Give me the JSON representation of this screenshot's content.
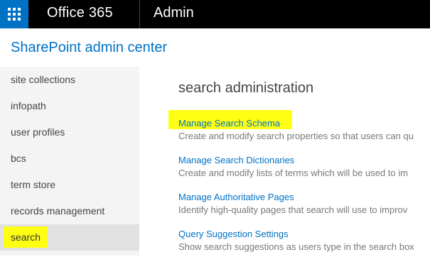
{
  "topbar": {
    "app_launcher_icon": "waffle-icon",
    "brand": "Office 365",
    "section": "Admin"
  },
  "site_title": "SharePoint admin center",
  "nav": {
    "items": [
      {
        "label": "site collections"
      },
      {
        "label": "infopath"
      },
      {
        "label": "user profiles"
      },
      {
        "label": "bcs"
      },
      {
        "label": "term store"
      },
      {
        "label": "records management"
      },
      {
        "label": "search",
        "selected": true
      }
    ]
  },
  "main": {
    "title": "search administration",
    "items": [
      {
        "link": "Manage Search Schema",
        "desc": "Create and modify search properties so that users can qu",
        "highlighted": true
      },
      {
        "link": "Manage Search Dictionaries",
        "desc": "Create and modify lists of terms which will be used to im"
      },
      {
        "link": "Manage Authoritative Pages",
        "desc": "Identify high-quality pages that search will use to improv"
      },
      {
        "link": "Query Suggestion Settings",
        "desc": "Show search suggestions as users type in the search box"
      }
    ]
  },
  "colors": {
    "topbar_bg": "#000000",
    "accent_blue": "#0072c6",
    "highlight_yellow": "#ffff14",
    "nav_bg": "#f4f4f4"
  }
}
